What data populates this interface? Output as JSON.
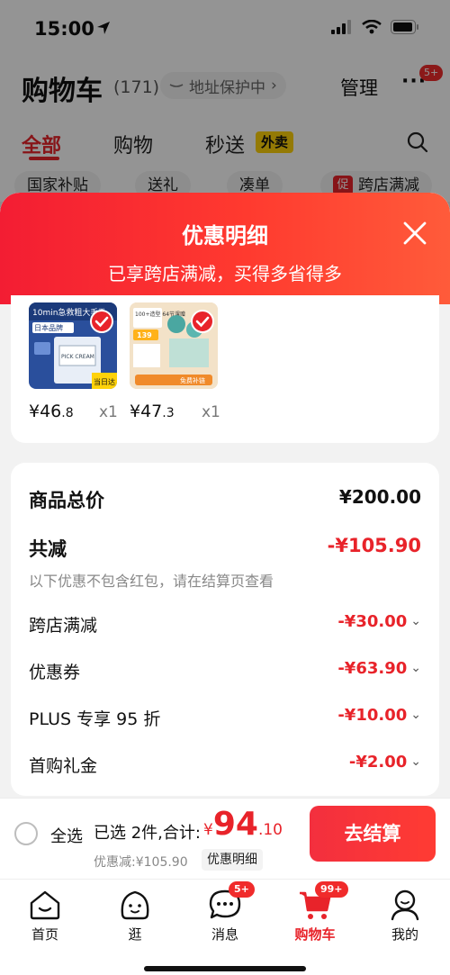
{
  "status_bar": {
    "time": "15:00"
  },
  "header": {
    "title": "购物车",
    "count": "(171)",
    "address_protect": "地址保护中",
    "manage": "管理",
    "more_badge": "5+"
  },
  "tabs": [
    {
      "label": "全部"
    },
    {
      "label": "购物"
    },
    {
      "label": "秒送"
    }
  ],
  "tab_tag": "外卖",
  "chips": [
    {
      "label": "国家补贴"
    },
    {
      "label": "送礼"
    },
    {
      "label": "凑单"
    },
    {
      "label": "跨店满减",
      "tag": "促"
    }
  ],
  "sheet": {
    "title": "优惠明细",
    "subtitle": "已享跨店满减，买得多省得多",
    "products": [
      {
        "price_int": "¥46",
        "price_dec": ".8",
        "qty": "x1",
        "img_top_text": "10min急救粗大毛孔",
        "img_brand": "日本品牌",
        "img_box_text": "PICK CREAM",
        "img_corner": "当日达"
      },
      {
        "price_int": "¥47",
        "price_dec": ".3",
        "qty": "x1",
        "img_top_text": "100+造型 64节课赠",
        "img_price": "139",
        "img_bottom": "免费补链"
      }
    ],
    "details": {
      "total_label": "商品总价",
      "total_value": "¥200.00",
      "reduce_label": "共减",
      "reduce_value": "-¥105.90",
      "note": "以下优惠不包含红包，请在结算页查看",
      "items": [
        {
          "label": "跨店满减",
          "value": "-¥30.00"
        },
        {
          "label": "优惠券",
          "value": "-¥63.90"
        },
        {
          "label": "PLUS 专享 95 折",
          "value": "-¥10.00"
        },
        {
          "label": "首购礼金",
          "value": "-¥2.00"
        }
      ]
    }
  },
  "settle": {
    "select_all": "全选",
    "selected": "已选 2件,合计:",
    "currency": "¥",
    "total_int": "94",
    "total_dec": ".10",
    "discount": "优惠减:¥105.90",
    "detail_link": "优惠明细",
    "checkout": "去结算"
  },
  "tabbar": [
    {
      "label": "首页",
      "icon": "home-icon"
    },
    {
      "label": "逛",
      "icon": "face-icon"
    },
    {
      "label": "消息",
      "icon": "message-icon",
      "badge": "5+"
    },
    {
      "label": "购物车",
      "icon": "cart-icon",
      "badge": "99+"
    },
    {
      "label": "我的",
      "icon": "profile-icon"
    }
  ],
  "colors": {
    "accent": "#e8232a",
    "sheet_header": "#f31d33",
    "checkout_button": "#f32f3e"
  }
}
